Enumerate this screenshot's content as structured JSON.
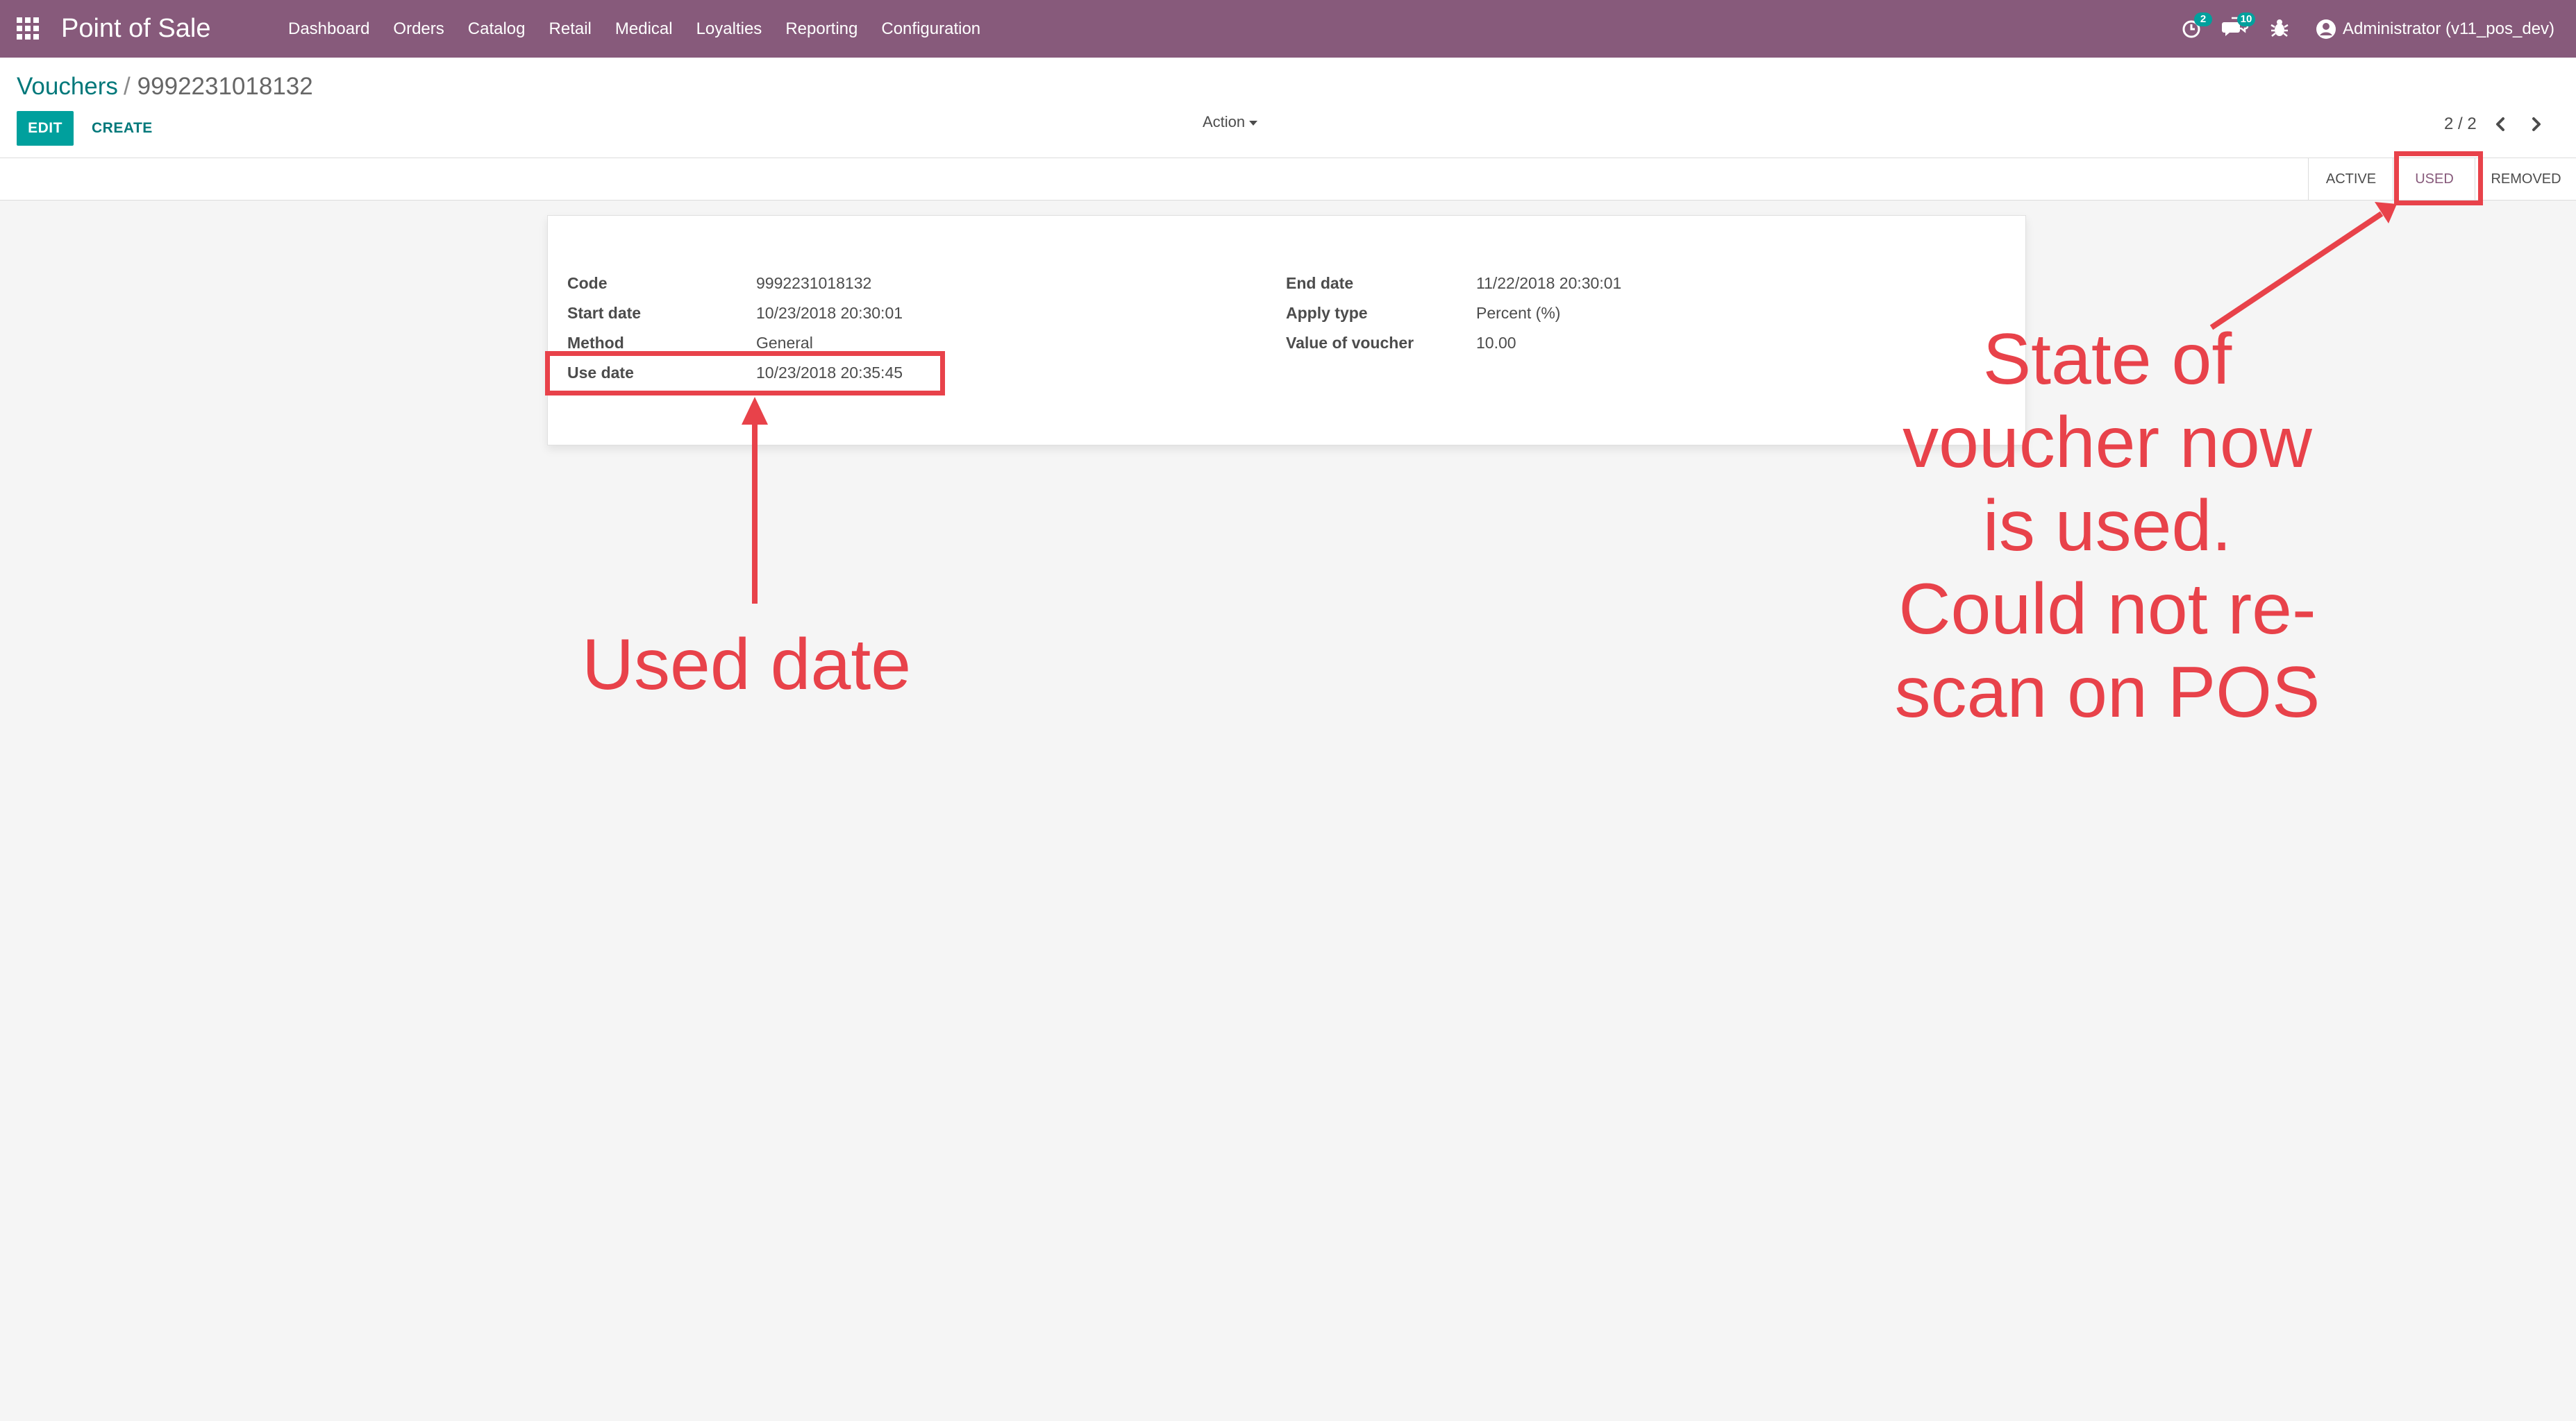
{
  "navbar": {
    "app_name": "Point of Sale",
    "menu": [
      {
        "label": "Dashboard"
      },
      {
        "label": "Orders"
      },
      {
        "label": "Catalog"
      },
      {
        "label": "Retail"
      },
      {
        "label": "Medical"
      },
      {
        "label": "Loyalties"
      },
      {
        "label": "Reporting"
      },
      {
        "label": "Configuration"
      }
    ],
    "activity_count": "2",
    "message_count": "10",
    "user_label": "Administrator (v11_pos_dev)",
    "icons": {
      "apps": "apps-grid-icon",
      "activity": "activity-clock-icon",
      "messages": "chat-bubbles-icon",
      "debug": "bug-icon",
      "user": "user-avatar-icon"
    }
  },
  "control_panel": {
    "breadcrumb_parent": "Vouchers",
    "breadcrumb_separator": "/",
    "breadcrumb_current": "9992231018132",
    "edit_label": "EDIT",
    "create_label": "CREATE",
    "action_label": "Action",
    "pager_value": "2 / 2"
  },
  "statusbar": {
    "stages": [
      {
        "label": "ACTIVE",
        "current": false
      },
      {
        "label": "USED",
        "current": true
      },
      {
        "label": "REMOVED",
        "current": false
      }
    ]
  },
  "form": {
    "left": [
      {
        "label": "Code",
        "value": "9992231018132"
      },
      {
        "label": "Start date",
        "value": "10/23/2018 20:30:01"
      },
      {
        "label": "Method",
        "value": "General"
      },
      {
        "label": "Use date",
        "value": "10/23/2018 20:35:45"
      }
    ],
    "right": [
      {
        "label": "End date",
        "value": "11/22/2018 20:30:01"
      },
      {
        "label": "Apply type",
        "value": "Percent (%)"
      },
      {
        "label": "Value of voucher",
        "value": "10.00"
      }
    ]
  },
  "annotations": {
    "used_date": "Used date",
    "state_lines": [
      "State of",
      "voucher now",
      "is used.",
      "Could not re-",
      "scan on POS"
    ]
  },
  "colors": {
    "navbar": "#875a7b",
    "primary_button": "#00a09d",
    "link": "#00787a",
    "annotation": "#e8424a"
  }
}
